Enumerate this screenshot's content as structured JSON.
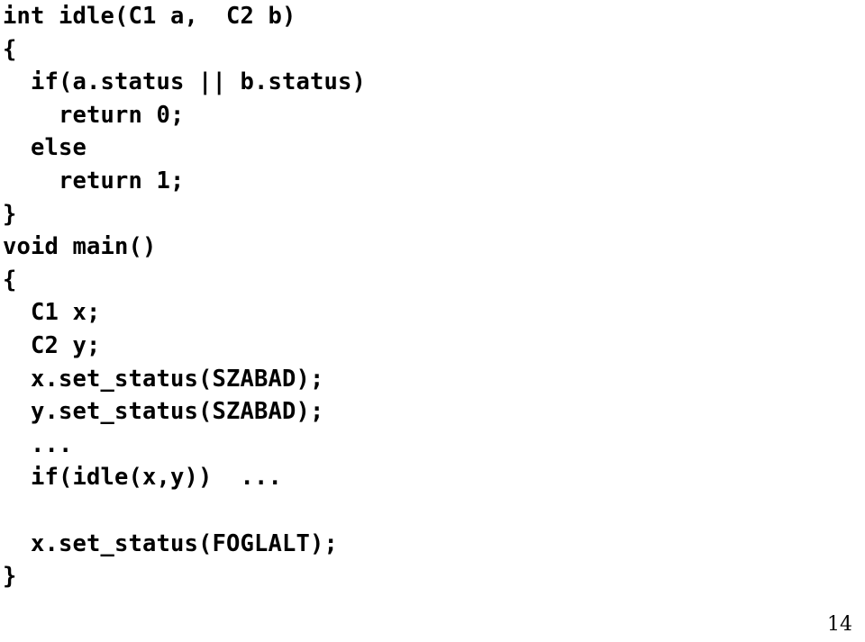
{
  "slide": {
    "background_color": "#ffffff",
    "text_color": "#000000",
    "page_number": "14",
    "code": {
      "language": "C++",
      "lines": [
        "int idle(C1 a,  C2 b)",
        "{",
        "  if(a.status || b.status)",
        "    return 0;",
        "  else",
        "    return 1;",
        "}",
        "void main()",
        "{",
        "  C1 x;",
        "  C2 y;",
        "  x.set_status(SZABAD);",
        "  y.set_status(SZABAD);",
        "  ...",
        "  if(idle(x,y))  ...",
        "",
        "  x.set_status(FOGLALT);",
        "}"
      ]
    }
  }
}
